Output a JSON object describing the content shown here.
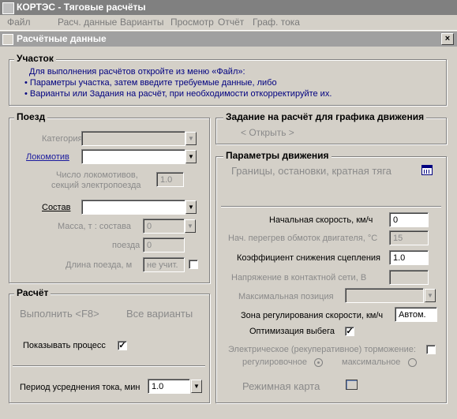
{
  "app": {
    "title": "КОРТЭС - Тяговые расчёты"
  },
  "menu": [
    "Файл",
    "Расч. данные",
    "Варианты",
    "Просмотр",
    "Отчёт",
    "Граф. тока"
  ],
  "window": {
    "title": "Расчётные данные",
    "close": "×"
  },
  "uchastok": {
    "title": "Участок",
    "line1": "Для выполнения расчётов откройте из меню  «Файл»:",
    "line2": "•  Параметры участка,  затем введите требуемые данные,       либо",
    "line3": "•  Варианты или Задания на расчёт,  при необходимости откорректируйте  их."
  },
  "poezd": {
    "title": "Поезд",
    "kategoria": "Категория",
    "lokomotiv": "Локомотив",
    "chislo_1": "Число  локомотивов,",
    "chislo_2": "секций  электропоезда",
    "chislo_value": "1.0",
    "sostav": "Состав",
    "massa_label": "Масса, т : состава",
    "massa_value": "0",
    "poezda_label": "поезда",
    "poezda_value": "0",
    "dlina_label": "Длина поезда, м",
    "dlina_value": "не учит."
  },
  "raschet": {
    "title": "Расчёт",
    "run": "Выполнить <F8>",
    "all": "Все варианты",
    "show_process": "Показывать процесс",
    "show_checked": "✓",
    "period_label": "Период усреднения тока, мин",
    "period_value": "1.0"
  },
  "zadanie": {
    "title": "Задание на расчёт для графика движения",
    "open": "< Открыть >"
  },
  "params": {
    "title": "Параметры движения",
    "granicy": "Границы, остановки, кратная тяга",
    "nach_speed_label": "Начальная  скорость, км/ч",
    "nach_speed_value": "0",
    "peregrev_label": "Нач. перегрев обмоток двигателя, °С",
    "peregrev_value": "15",
    "koef_label": "Коэффициент снижения сцепления",
    "koef_value": "1.0",
    "napryazh_label": "Напряжение в контактной сети, В",
    "maxpos_label": "Максимальная позиция",
    "zona_label": "Зона регулирования скорости, км/ч",
    "zona_value": "Автом.",
    "optim_label": "Оптимизация выбега",
    "optim_checked": "✓",
    "elektr_label": "Электрическое (рекуперативное) торможение:",
    "reg_label": "регулировочное",
    "max_label": "максимальное",
    "rezhim_label": "Режимная карта"
  },
  "icons": {
    "dropdown": "▼",
    "calendar": "calendar-icon",
    "map": "map-icon"
  }
}
